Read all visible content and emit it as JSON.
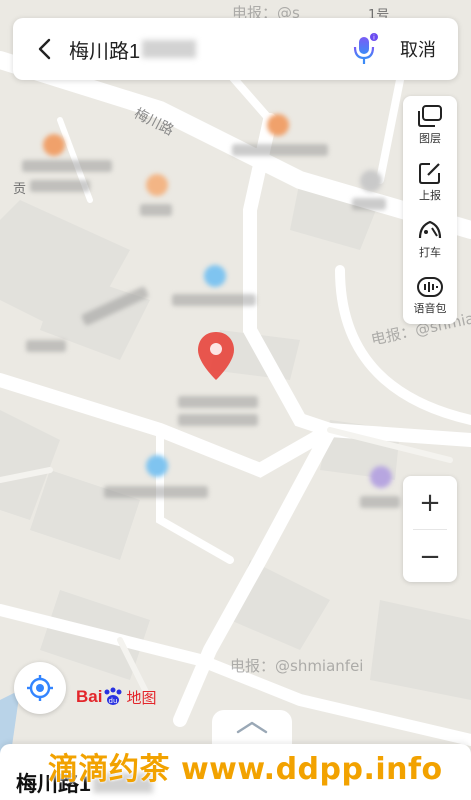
{
  "search": {
    "query": "梅川路1",
    "cancel_label": "取消"
  },
  "tools": [
    {
      "label": "图层",
      "icon": "layers-icon"
    },
    {
      "label": "上报",
      "icon": "report-icon"
    },
    {
      "label": "打车",
      "icon": "taxi-icon"
    },
    {
      "label": "语音包",
      "icon": "voice-pack-icon"
    }
  ],
  "zoom": {
    "in_label": "+",
    "out_label": "−"
  },
  "map": {
    "road_name": "梅川路",
    "building_label": "1号",
    "district_label": "贡",
    "watermarks": [
      "电报：@s",
      "电报：@shmia",
      "电报：@shmianfei"
    ]
  },
  "brand": {
    "logo_text": "Bai",
    "logo_suffix": "地图"
  },
  "sheet": {
    "title": "梅川路1"
  },
  "overlay": {
    "text": "滴滴约茶 www.ddpp.info"
  },
  "colors": {
    "accent": "#3385ff",
    "pin": "#e8453c",
    "brand": "#e3262b",
    "overlay": "#f2a200"
  }
}
